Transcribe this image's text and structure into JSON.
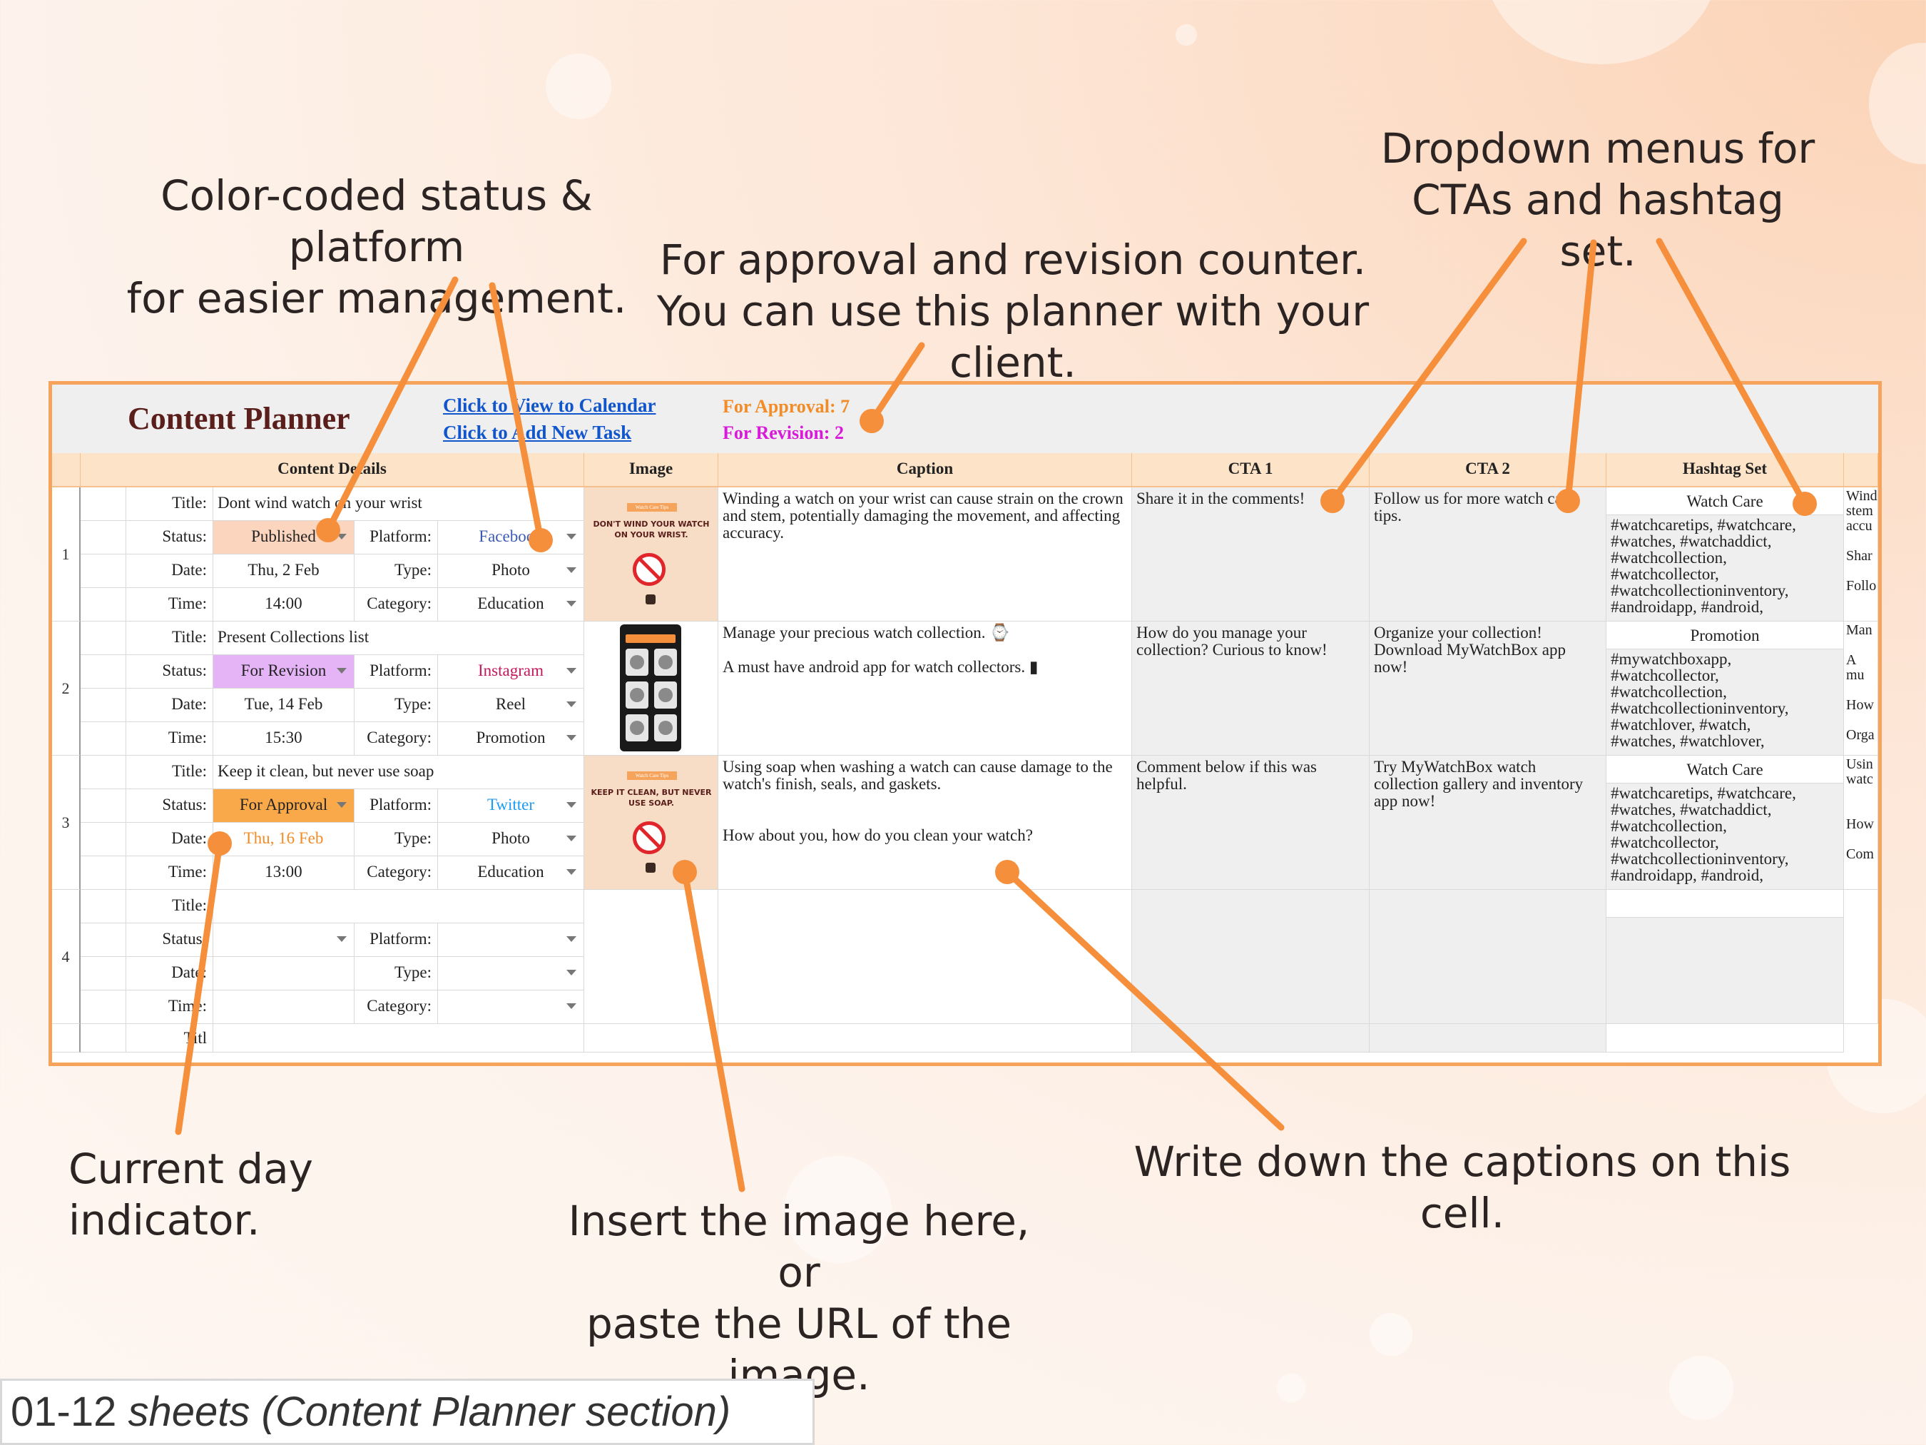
{
  "callouts": {
    "status_platform": "Color-coded status & platform\nfor easier management.",
    "approval": "For approval and revision counter.\nYou can use this planner with your client.",
    "dropdown": "Dropdown menus for\nCTAs and hashtag set.",
    "current_day": "Current day indicator.",
    "image": "Insert the image here, or\npaste the URL of the image.",
    "caption": "Write down the captions on this cell."
  },
  "sheet": {
    "title": "Content Planner",
    "link_calendar": "Click to View to Calendar",
    "link_new_task": "Click to Add New Task",
    "for_approval": "For Approval: 7",
    "for_revision": "For Revision: 2",
    "headers": {
      "details": "Content Details",
      "image": "Image",
      "caption": "Caption",
      "cta1": "CTA 1",
      "cta2": "CTA 2",
      "hashtag": "Hashtag Set"
    },
    "labels": {
      "title": "Title:",
      "status": "Status:",
      "date": "Date:",
      "time": "Time:",
      "platform": "Platform:",
      "type": "Type:",
      "category": "Category:"
    },
    "rows": [
      {
        "num": "1",
        "title": "Dont wind watch on your wrist",
        "status": "Published",
        "date": "Thu, 2 Feb",
        "time": "14:00",
        "platform": "Facebook",
        "type": "Photo",
        "category": "Education",
        "caption": "Winding a watch on your wrist can cause strain on the crown and stem, potentially damaging the movement, and affecting accuracy.",
        "cta1": "Share it in the comments!",
        "cta2": "Follow us for more watch care tips.",
        "hashtag_set": "Watch Care",
        "hashtags": "#watchcaretips, #watchcare,\n#watches, #watchaddict,\n#watchcollection,\n#watchcollector,\n#watchcollectioninventory,\n#androidapp, #android,",
        "image_text": "DON'T WIND YOUR WATCH ON YOUR WRIST.",
        "image_tag": "Watch Care Tips",
        "overflow": "Wind\nstem\naccu\n\nShar\n\nFollo"
      },
      {
        "num": "2",
        "title": "Present Collections list",
        "status": "For Revision",
        "date": "Tue, 14 Feb",
        "time": "15:30",
        "platform": "Instagram",
        "type": "Reel",
        "category": "Promotion",
        "caption": "Manage your precious watch collection. ⌚\n\nA must have android app for watch collectors. ▮",
        "cta1": "How do you manage your collection? Curious to know!",
        "cta2": "Organize your collection! Download MyWatchBox app now!",
        "hashtag_set": "Promotion",
        "hashtags": "#mywatchboxapp,\n#watchcollector,\n#watchcollection,\n#watchcollectioninventory,\n#watchlover, #watch,\n#watches, #watchlover,",
        "image_text": "",
        "image_tag": "",
        "overflow": "Man\n\nA mu\n\nHow\n\nOrga"
      },
      {
        "num": "3",
        "title": "Keep it clean, but never use soap",
        "status": "For Approval",
        "date": "Thu, 16 Feb",
        "time": "13:00",
        "platform": "Twitter",
        "type": "Photo",
        "category": "Education",
        "caption": "Using soap when washing a watch can cause damage to the watch's finish, seals, and gaskets.\n\n\nHow about you, how do you clean your watch?",
        "cta1": "Comment below if this was helpful.",
        "cta2": "Try MyWatchBox watch collection gallery and inventory app now!",
        "hashtag_set": "Watch Care",
        "hashtags": "#watchcaretips, #watchcare,\n#watches, #watchaddict,\n#watchcollection,\n#watchcollector,\n#watchcollectioninventory,\n#androidapp, #android,",
        "image_text": "KEEP IT CLEAN, BUT NEVER USE SOAP.",
        "image_tag": "Watch Care Tips",
        "overflow": "Usin\nwatc\n\n\nHow\n\nCom"
      },
      {
        "num": "4",
        "title": "",
        "status": "",
        "date": "",
        "time": "",
        "platform": "",
        "type": "",
        "category": "",
        "caption": "",
        "cta1": "",
        "cta2": "",
        "hashtag_set": "",
        "hashtags": "",
        "image_text": "",
        "image_tag": "",
        "overflow": ""
      }
    ],
    "row5_title_label": "Titl"
  },
  "colors": {
    "published": "#fcd5bf",
    "for_revision": "#e4b4f7",
    "for_approval": "#f9a94a",
    "facebook": "#3b5bb5",
    "instagram": "#c2185b",
    "twitter": "#1d9bf0",
    "approval_text": "#f28c28",
    "revision_text": "#d81bd8",
    "accent_orange": "#f58f3b"
  },
  "footer": {
    "prefix": "01-12",
    "italic": "sheets (Content Planner section)"
  }
}
